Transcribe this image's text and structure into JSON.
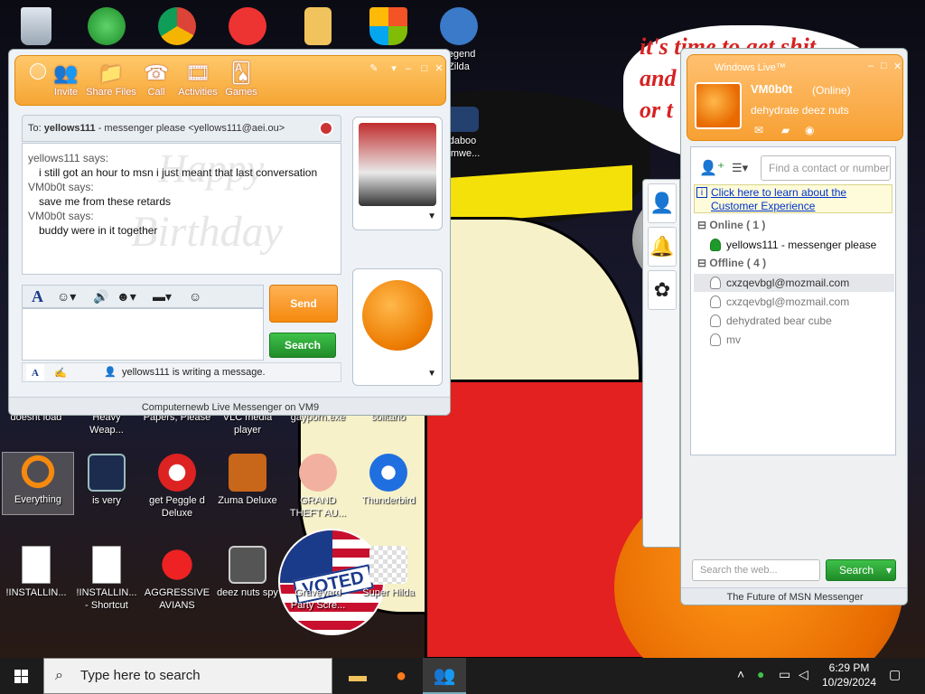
{
  "wallpaper": {
    "bubble_lines": [
      "it's time to get shit",
      "and",
      "or t"
    ],
    "stamp": "VOTED"
  },
  "desktop_icons": [
    {
      "label": "",
      "x": 0
    },
    {
      "label": "",
      "x": 0
    },
    {
      "label": "Legend\nZilda"
    },
    {
      "label": "daboo\nomwe..."
    },
    {
      "label": "doesnt load"
    },
    {
      "label": "Heavy\nWeap..."
    },
    {
      "label": "Papers, Please"
    },
    {
      "label": "VLC media\nplayer"
    },
    {
      "label": "gayporn.exe"
    },
    {
      "label": "solitario"
    },
    {
      "label": "Everything"
    },
    {
      "label": "is very"
    },
    {
      "label": "get Peggle d\nDeluxe"
    },
    {
      "label": "Zuma Deluxe"
    },
    {
      "label": "GRAND\nTHEFT AU..."
    },
    {
      "label": "Thunderbird"
    },
    {
      "label": "!INSTALLIN..."
    },
    {
      "label": "!INSTALLIN...\n- Shortcut"
    },
    {
      "label": "AGGRESSIVE\nAVIANS"
    },
    {
      "label": "deez nuts spy"
    },
    {
      "label": "Graveyard\nParty Scre..."
    },
    {
      "label": "Super Hilda"
    }
  ],
  "conversation": {
    "toolbar": [
      "Invite",
      "Share Files",
      "Call",
      "Activities",
      "Games"
    ],
    "to_label": "To:",
    "to_name": "yellows111",
    "to_detail": " - messenger please <yellows111@aei.ou>",
    "messages": [
      {
        "who": "yellows111 says:",
        "text": "i still got an hour to msn i just meant that last conversation"
      },
      {
        "who": "VM0b0t says:",
        "text": "save me from these retards"
      },
      {
        "who": "VM0b0t says:",
        "text": "buddy were in it together"
      }
    ],
    "watermark_1": "Happy",
    "watermark_2": "Birthday",
    "send": "Send",
    "search": "Search",
    "typing_status": "yellows111 is writing a message.",
    "footer": "Computernewb Live Messenger on VM9"
  },
  "contacts": {
    "brand": "Windows Live™",
    "user_name": "VM0b0t",
    "user_status": "(Online)",
    "user_message": "dehydrate deez nuts",
    "find_placeholder": "Find a contact or number...",
    "info_text": "Click here to learn about the Customer Experience",
    "online_group": "Online ( 1 )",
    "online": [
      {
        "name": "yellows111 - messenger please"
      }
    ],
    "offline_group": "Offline ( 4 )",
    "offline": [
      {
        "name": "cxzqevbgl@mozmail.com"
      },
      {
        "name": "cxzqevbgl@mozmail.com"
      },
      {
        "name": "dehydrated bear cube"
      },
      {
        "name": "mv"
      }
    ],
    "web_placeholder": "Search the web...",
    "web_button": "Search",
    "footer": "The Future of MSN Messenger"
  },
  "taskbar": {
    "search_placeholder": "Type here to search",
    "time": "6:29 PM",
    "date": "10/29/2024"
  },
  "colors": {
    "accent_orange": "#f5a534",
    "search_green": "#1f8b28",
    "link_blue": "#0033cc"
  }
}
